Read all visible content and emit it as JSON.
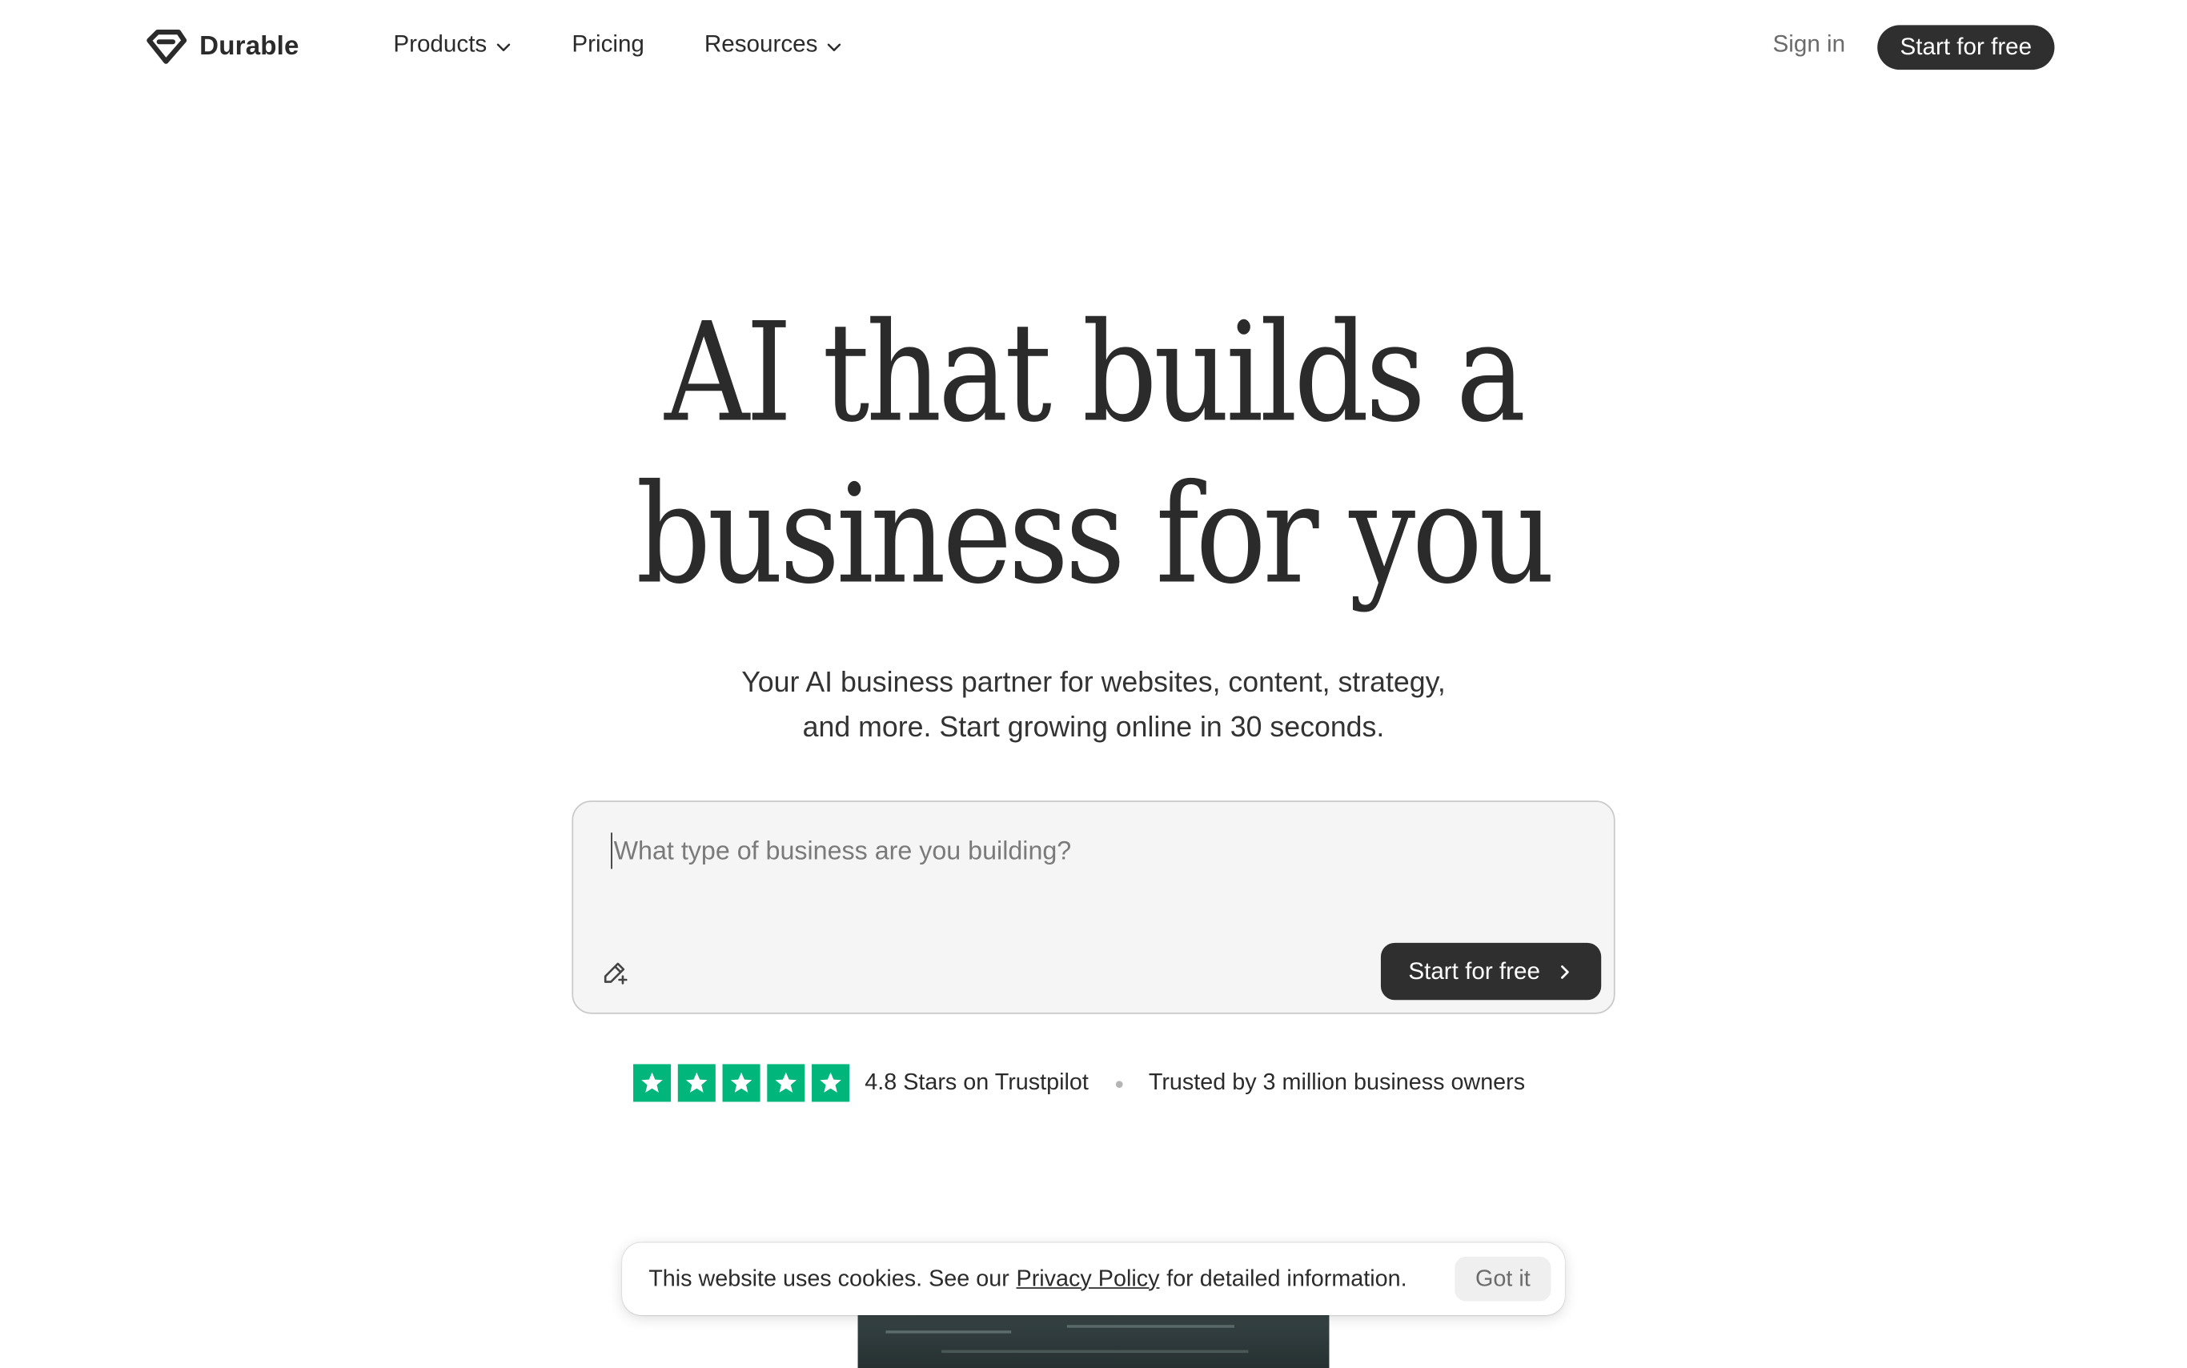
{
  "header": {
    "brand": "Durable",
    "nav": [
      {
        "label": "Products",
        "has_dropdown": true,
        "icon": "chevron-down-icon"
      },
      {
        "label": "Pricing",
        "has_dropdown": false
      },
      {
        "label": "Resources",
        "has_dropdown": true,
        "icon": "chevron-down-icon"
      }
    ],
    "sign_in": "Sign in",
    "cta": "Start for free"
  },
  "hero": {
    "title_line1": "AI that builds a",
    "title_line2": "business for you",
    "subtitle_line1": "Your AI business partner for websites, content, strategy,",
    "subtitle_line2": "and more. Start growing online in 30 seconds."
  },
  "prompt": {
    "value": "",
    "placeholder": "What type of business are you building?",
    "left_icon": "magic-wand-icon",
    "cta": "Start for free",
    "cta_icon": "chevron-right-icon"
  },
  "trust": {
    "stars": 5,
    "star_color": "#00b67a",
    "rating_text": "4.8 Stars on Trustpilot",
    "trusted_text": "Trusted by 3 million business owners"
  },
  "cookie": {
    "text_before": "This website uses cookies. See our",
    "link": "Privacy Policy",
    "text_after": "for detailed information.",
    "button": "Got it"
  },
  "colors": {
    "text": "#2b2b2b",
    "button_dark": "#2f2f2f",
    "trustpilot_green": "#00b67a",
    "input_bg": "#f5f5f5"
  }
}
